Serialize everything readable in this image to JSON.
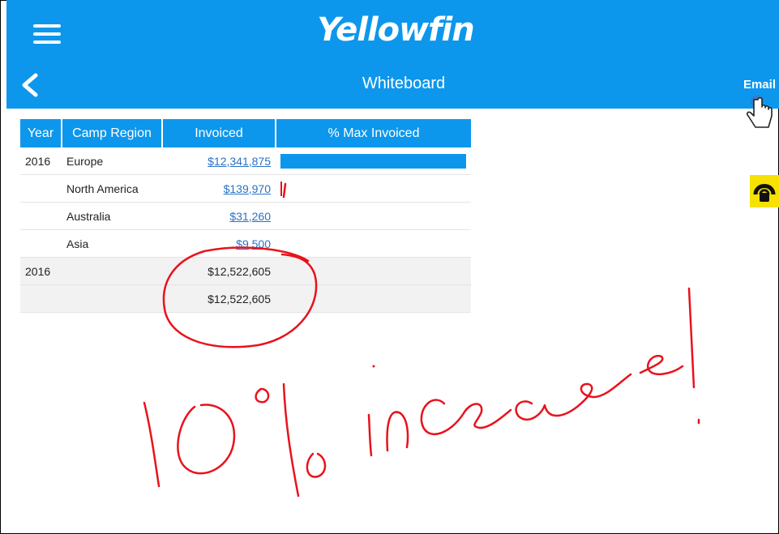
{
  "header": {
    "logo_text": "Yellowfin",
    "title": "Whiteboard",
    "email_label": "Email"
  },
  "table": {
    "columns": [
      "Year",
      "Camp Region",
      "Invoiced",
      "% Max Invoiced"
    ],
    "rows": [
      {
        "year": "2016",
        "region": "Europe",
        "invoiced": "$12,341,875",
        "pct": 1.0
      },
      {
        "year": "",
        "region": "North America",
        "invoiced": "$139,970",
        "pct": 0.011
      },
      {
        "year": "",
        "region": "Australia",
        "invoiced": "$31,260",
        "pct": 0.0025
      },
      {
        "year": "",
        "region": "Asia",
        "invoiced": "$9,500",
        "pct": 0.0008
      }
    ],
    "subtotal": {
      "year": "2016",
      "invoiced": "$12,522,605"
    },
    "grand_total": {
      "invoiced": "$12,522,605"
    }
  },
  "colors": {
    "accent": "#0d97ec",
    "ink": "#e8121c",
    "lock": "#f6e100"
  },
  "icons": [
    "menu-icon",
    "back-icon",
    "hand-pointer-icon",
    "lock-icon"
  ]
}
